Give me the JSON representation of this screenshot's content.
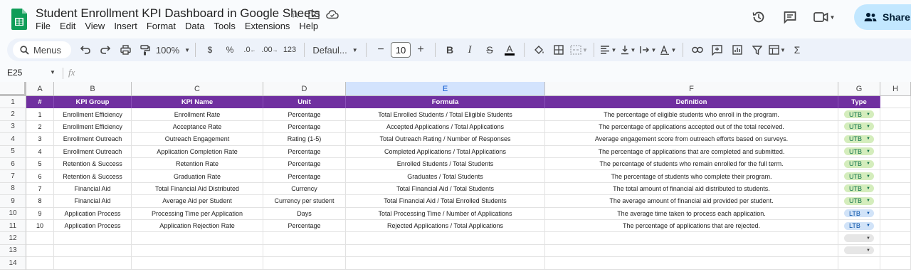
{
  "app": {
    "title": "Student Enrollment KPI Dashboard in Google Sheets",
    "menu": [
      "File",
      "Edit",
      "View",
      "Insert",
      "Format",
      "Data",
      "Tools",
      "Extensions",
      "Help"
    ],
    "share_label": "Share",
    "colors": {
      "brand_green": "#0f9d58",
      "header_purple": "#7030a0",
      "share_bg": "#c2e7ff"
    }
  },
  "toolbar": {
    "search_label": "Menus",
    "zoom": "100%",
    "currency": "$",
    "percent": "%",
    "dec_decrease": ".0",
    "dec_increase": ".00",
    "number_format": "123",
    "font": "Defaul...",
    "font_size": "10",
    "bold": "B",
    "italic": "I",
    "strike": "S",
    "text_color": "A"
  },
  "formula_bar": {
    "cell_ref": "E25",
    "fx": "fx",
    "value": ""
  },
  "grid": {
    "columns": [
      "A",
      "B",
      "C",
      "D",
      "E",
      "F",
      "G",
      "H"
    ],
    "row_numbers": [
      "1",
      "2",
      "3",
      "4",
      "5",
      "6",
      "7",
      "8",
      "9",
      "10",
      "11",
      "12",
      "13",
      "14"
    ],
    "header": [
      "#",
      "KPI Group",
      "KPI Name",
      "Unit",
      "Formula",
      "Definition",
      "Type"
    ],
    "rows": [
      [
        "1",
        "Enrollment Efficiency",
        "Enrollment Rate",
        "Percentage",
        "Total Enrolled Students / Total Eligible Students",
        "The percentage of eligible students who enroll in the program.",
        "UTB"
      ],
      [
        "2",
        "Enrollment Efficiency",
        "Acceptance Rate",
        "Percentage",
        "Accepted Applications / Total Applications",
        "The percentage of applications accepted out of the total received.",
        "UTB"
      ],
      [
        "3",
        "Enrollment Outreach",
        "Outreach Engagement",
        "Rating (1-5)",
        "Total Outreach Rating / Number of Responses",
        "Average engagement score from outreach efforts based on surveys.",
        "UTB"
      ],
      [
        "4",
        "Enrollment Outreach",
        "Application Completion Rate",
        "Percentage",
        "Completed Applications / Total Applications",
        "The percentage of applications that are completed and submitted.",
        "UTB"
      ],
      [
        "5",
        "Retention & Success",
        "Retention Rate",
        "Percentage",
        "Enrolled Students / Total Students",
        "The percentage of students who remain enrolled for the full term.",
        "UTB"
      ],
      [
        "6",
        "Retention & Success",
        "Graduation Rate",
        "Percentage",
        "Graduates / Total Students",
        "The percentage of students who complete their program.",
        "UTB"
      ],
      [
        "7",
        "Financial Aid",
        "Total Financial Aid Distributed",
        "Currency",
        "Total Financial Aid / Total Students",
        "The total amount of financial aid distributed to students.",
        "UTB"
      ],
      [
        "8",
        "Financial Aid",
        "Average Aid per Student",
        "Currency per student",
        "Total Financial Aid / Total Enrolled Students",
        "The average amount of financial aid provided per student.",
        "UTB"
      ],
      [
        "9",
        "Application Process",
        "Processing Time per Application",
        "Days",
        "Total Processing Time / Number of Applications",
        "The average time taken to process each application.",
        "LTB"
      ],
      [
        "10",
        "Application Process",
        "Application Rejection Rate",
        "Percentage",
        "Rejected Applications / Total Applications",
        "The percentage of applications that are rejected.",
        "LTB"
      ]
    ]
  }
}
